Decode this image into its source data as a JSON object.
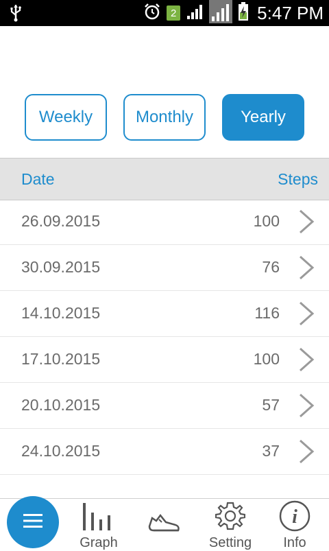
{
  "status_bar": {
    "time": "5:47 PM",
    "sim_slot": "2",
    "icons": [
      "usb-icon",
      "alarm-icon",
      "sim-icon",
      "signal-icon",
      "signal-icon",
      "battery-charging-icon"
    ]
  },
  "period_tabs": [
    {
      "label": "Weekly",
      "active": false
    },
    {
      "label": "Monthly",
      "active": false
    },
    {
      "label": "Yearly",
      "active": true
    }
  ],
  "table": {
    "headers": {
      "date": "Date",
      "steps": "Steps"
    },
    "rows": [
      {
        "date": "26.09.2015",
        "steps": "100"
      },
      {
        "date": "30.09.2015",
        "steps": "76"
      },
      {
        "date": "14.10.2015",
        "steps": "116"
      },
      {
        "date": "17.10.2015",
        "steps": "100"
      },
      {
        "date": "20.10.2015",
        "steps": "57"
      },
      {
        "date": "24.10.2015",
        "steps": "37"
      }
    ]
  },
  "bottom_nav": {
    "items": [
      {
        "label": "",
        "icon": "menu-icon"
      },
      {
        "label": "Graph",
        "icon": "bar-graph-icon"
      },
      {
        "label": "",
        "icon": "shoe-icon"
      },
      {
        "label": "Setting",
        "icon": "gear-icon"
      },
      {
        "label": "Info",
        "icon": "info-icon"
      }
    ]
  },
  "colors": {
    "accent": "#1e8ccd",
    "header_bg": "#e3e3e3",
    "text_muted": "#6b6b6b"
  }
}
